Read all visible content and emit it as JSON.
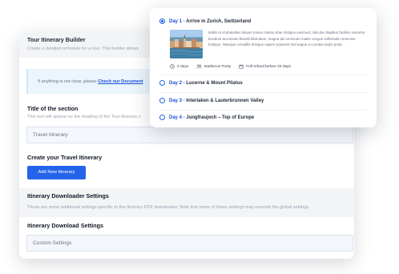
{
  "builder": {
    "title": "Tour Itinerary Builder",
    "subtitle": "Create a detailed schedule for a tour. This builder allows",
    "notice_text": "If anything is not clear, please",
    "notice_link": "Check our Document",
    "section_title": "Title of the section",
    "section_help": "This text will appear as the heading of the Tour Itinerary s",
    "section_value": "Travel Itinerary",
    "create_title": "Create your Travel Itinerary",
    "add_button": "Add New Itinerary",
    "downloader_title": "Itinerary Downloader Settings",
    "downloader_help": "These are some additional settings specific to the Itinerary PDF downloader. Note that some of these settings may override the global settings.",
    "download_settings_title": "Itinerary Download Settings",
    "download_settings_value": "Custom Settings"
  },
  "itinerary": {
    "days": [
      {
        "num": "Day 1",
        "sep": " - ",
        "name": "Arrive in Zurich, Switzerland",
        "selected": true
      },
      {
        "num": "Day 2",
        "sep": " - ",
        "name": "Lucerne & Mount Pilatus",
        "selected": false
      },
      {
        "num": "Day 3",
        "sep": " - ",
        "name": "Interlaken & Lauterbrunnen Valley",
        "selected": false
      },
      {
        "num": "Day 4",
        "sep": " - ",
        "name": "Jungfraujoch – Top of Europe",
        "selected": false
      }
    ],
    "description": "Mollis et id phasellus aliquet metus massa vitae tristique euismod, ridiculus dapibus facilisis nascetur tincidunt accumsan blandit bibendum, magna ad commodo mattis congue sollicitudin senectus tristique. Natoque convallis tristique sapien praesent sed augue a conubia turpis porta.",
    "meta": {
      "duration": "4 days",
      "activity": "Barbecue Party",
      "refund": "Full refund before 25 days"
    }
  },
  "colors": {
    "accent": "#2563eb",
    "field_bg": "#f4f7fc",
    "notice_bg": "#eaf5fd",
    "band_bg": "#f3f4f6"
  },
  "icons": {
    "duration": "clock-icon",
    "activity": "people-icon",
    "refund": "calendar-icon"
  }
}
